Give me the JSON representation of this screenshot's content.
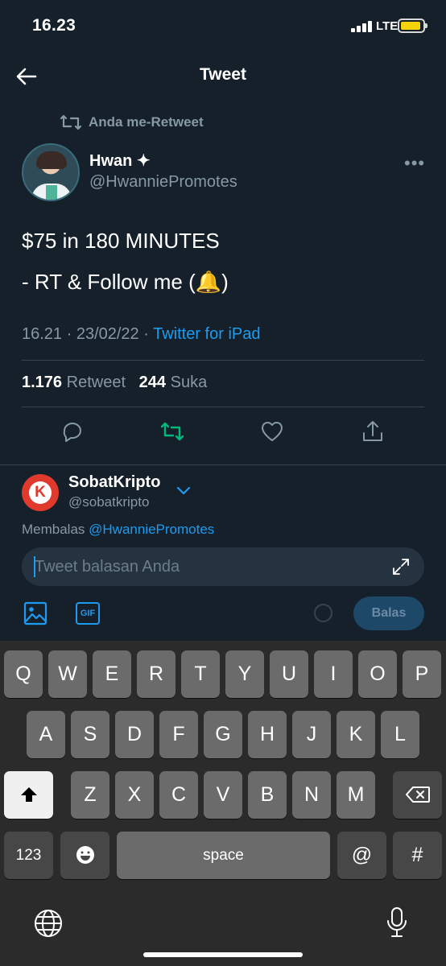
{
  "status_bar": {
    "time": "16.23",
    "network": "LTE"
  },
  "header": {
    "title": "Tweet"
  },
  "tweet": {
    "retweet_label": "Anda me-Retweet",
    "author_name": "Hwan ✦",
    "author_handle": "@HwanniePromotes",
    "more_label": "•••",
    "text_lines": [
      "$75 in 180 MINUTES",
      "- RT & Follow me (🔔)"
    ],
    "timestamp": "16.21 · 23/02/22 · ",
    "source": "Twitter for iPad",
    "retweet_count": "1.176",
    "retweet_label_stat": "Retweet",
    "like_count": "244",
    "like_label": "Suka",
    "retweeted_color": "#00ba7c"
  },
  "reply": {
    "user_name": "SobatKripto",
    "user_handle": "@sobatkripto",
    "avatar_letter": "K",
    "replying_prefix": "Membalas ",
    "replying_to": "@HwanniePromotes",
    "placeholder": "Tweet balasan Anda",
    "gif_label": "GIF",
    "button_label": "Balas"
  },
  "keyboard": {
    "row1": [
      "Q",
      "W",
      "E",
      "R",
      "T",
      "Y",
      "U",
      "I",
      "O",
      "P"
    ],
    "row2": [
      "A",
      "S",
      "D",
      "F",
      "G",
      "H",
      "J",
      "K",
      "L"
    ],
    "row3": [
      "Z",
      "X",
      "C",
      "V",
      "B",
      "N",
      "M"
    ],
    "numbers_label": "123",
    "space_label": "space",
    "at_label": "@",
    "hash_label": "#"
  }
}
